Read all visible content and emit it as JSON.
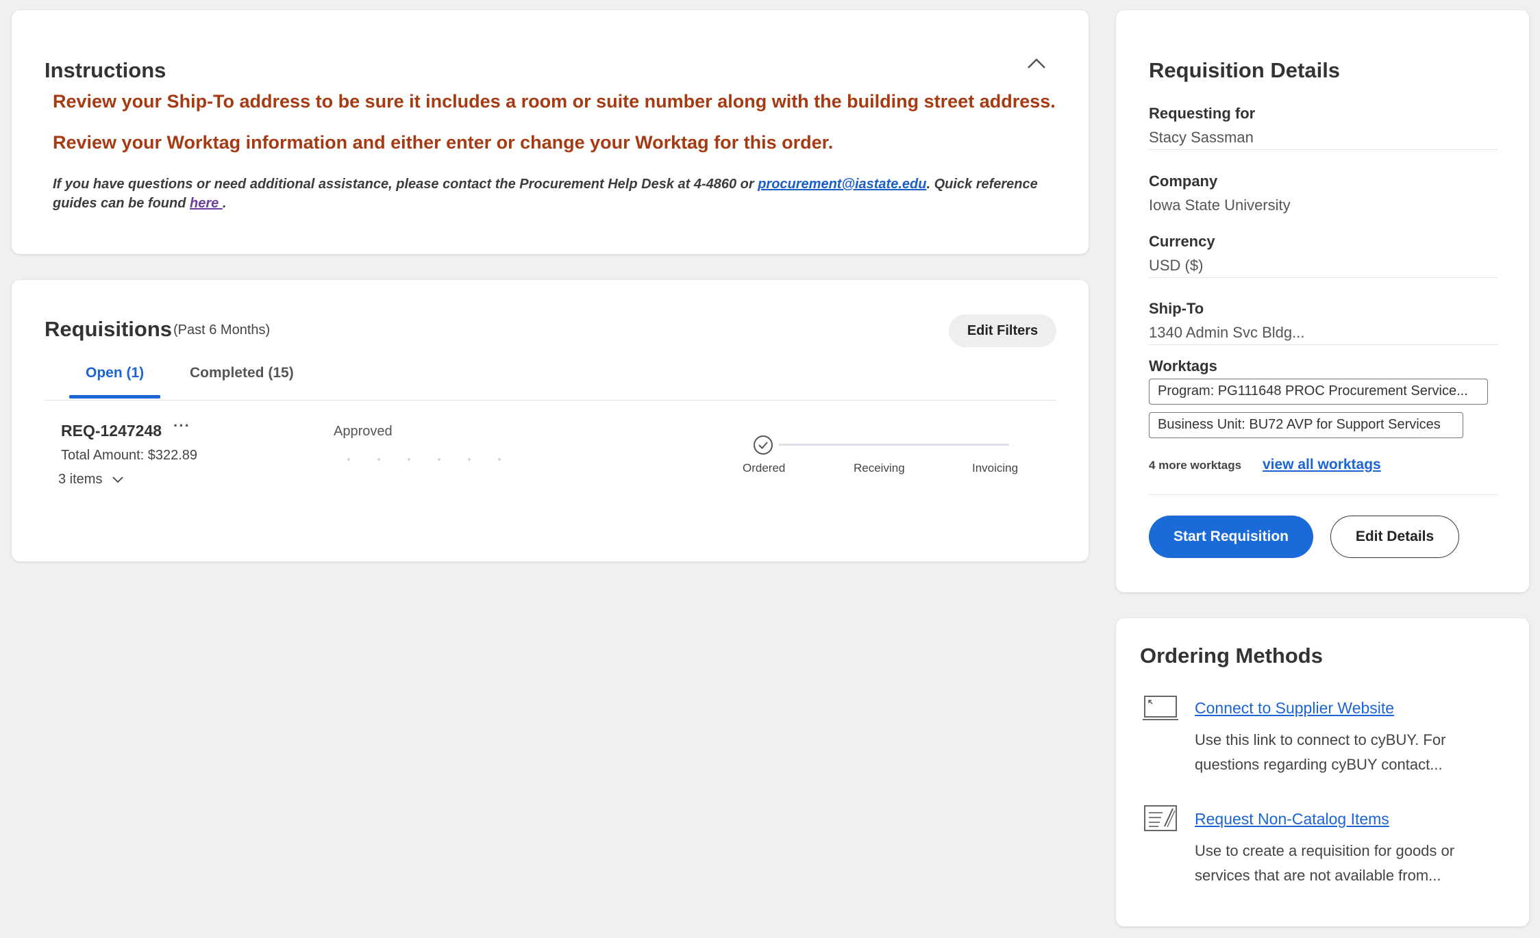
{
  "instructions": {
    "title": "Instructions",
    "line1": "Review your Ship-To address to be sure it includes a room or suite number along with the building street address.",
    "line2": "Review your Worktag information and either enter or change your Worktag for this order.",
    "help_prefix": "If you have questions or need additional assistance, please contact the Procurement Help Desk at 4-4860 or ",
    "help_email": "procurement@iastate.edu",
    "help_middle": ". Quick reference guides can be found ",
    "help_link": "here ",
    "help_suffix": "."
  },
  "requisitions": {
    "title": "Requisitions",
    "subtitle": "(Past 6 Months)",
    "edit_filters": "Edit Filters",
    "tabs": [
      {
        "label": "Open (1)",
        "active": true
      },
      {
        "label": "Completed (15)",
        "active": false
      }
    ],
    "item": {
      "id": "REQ-1247248",
      "more": "···",
      "total": "Total Amount: $322.89",
      "items": "3 items",
      "status": "Approved",
      "stages": [
        "Ordered",
        "Receiving",
        "Invoicing"
      ]
    }
  },
  "details": {
    "title": "Requisition Details",
    "fields": [
      {
        "label": "Requesting for",
        "value": "Stacy Sassman"
      },
      {
        "label": "Company",
        "value": "Iowa State University"
      },
      {
        "label": "Currency",
        "value": "USD ($)"
      },
      {
        "label": "Ship-To",
        "value": "1340 Admin Svc Bldg..."
      }
    ],
    "worktags_label": "Worktags",
    "worktags": [
      "Program: PG111648 PROC Procurement Service...",
      "Business Unit: BU72 AVP for Support Services"
    ],
    "more_worktags": "4 more worktags",
    "view_all": "view all worktags",
    "start_button": "Start Requisition",
    "edit_button": "Edit Details",
    "accent_color": "#1a6bd8"
  },
  "ordering": {
    "title": "Ordering Methods",
    "methods": [
      {
        "icon": "laptop-icon",
        "link": "Connect to Supplier Website",
        "desc": "Use this link to connect to cyBUY. For questions regarding cyBUY contact..."
      },
      {
        "icon": "form-edit-icon",
        "link": "Request Non-Catalog Items",
        "desc": "Use to create a requisition for goods or services that are not available from..."
      }
    ]
  },
  "colors": {
    "instruction_text": "#a63a12",
    "link": "#1a64d6",
    "background": "#eff0f2"
  }
}
